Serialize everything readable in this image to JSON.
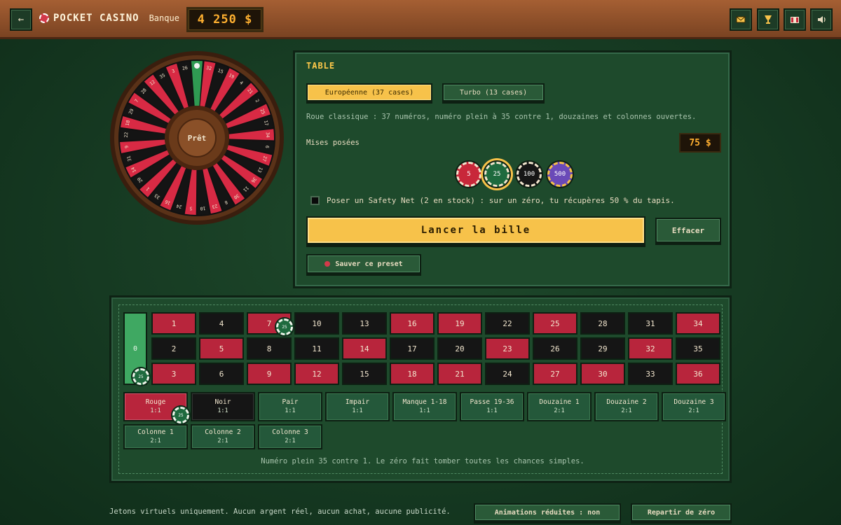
{
  "header": {
    "back_icon": "←",
    "brand": "POCKET CASINO",
    "bank_label": "Banque",
    "bank_value": "4 250 $",
    "icons": [
      "envelope-icon",
      "trophy-icon",
      "gift-icon",
      "speaker-icon"
    ]
  },
  "wheel": {
    "center_label": "Prêt",
    "numbers": [
      0,
      32,
      15,
      19,
      4,
      21,
      2,
      25,
      17,
      34,
      6,
      27,
      13,
      36,
      11,
      30,
      8,
      23,
      10,
      5,
      24,
      16,
      33,
      1,
      20,
      14,
      31,
      9,
      22,
      18,
      29,
      7,
      28,
      12,
      35,
      3,
      26
    ]
  },
  "table": {
    "title": "TABLE",
    "mode_european": "Européenne (37 cases)",
    "mode_turbo": "Turbo (13 cases)",
    "description": "Roue classique : 37 numéros, numéro plein à 35 contre 1, douzaines et colonnes ouvertes.",
    "mises_label": "Mises posées",
    "mises_value": "75 $",
    "chips": [
      {
        "label": "5",
        "color": "#c8283a"
      },
      {
        "label": "25",
        "color": "#1e6a3e"
      },
      {
        "label": "100",
        "color": "#161616"
      },
      {
        "label": "500",
        "color": "#6a4ab8"
      }
    ],
    "safety_net": "Poser un Safety Net (2 en stock) : sur un zéro, tu récupères 50 % du tapis.",
    "launch_label": "Lancer la bille",
    "clear_label": "Effacer",
    "preset_label": "Sauver ce preset"
  },
  "board": {
    "zero": "0",
    "rows": [
      [
        3,
        6,
        9,
        12,
        15,
        18,
        21,
        24,
        27,
        30,
        33,
        36
      ],
      [
        2,
        5,
        8,
        11,
        14,
        17,
        20,
        23,
        26,
        29,
        32,
        35
      ],
      [
        1,
        4,
        7,
        10,
        13,
        16,
        19,
        22,
        25,
        28,
        31,
        34
      ]
    ],
    "red_numbers": [
      1,
      3,
      5,
      7,
      9,
      12,
      14,
      16,
      18,
      19,
      21,
      23,
      25,
      27,
      30,
      32,
      34,
      36
    ],
    "outside_row1": [
      {
        "label": "Rouge",
        "odds": "1:1",
        "style": "red"
      },
      {
        "label": "Noir",
        "odds": "1:1",
        "style": "black"
      },
      {
        "label": "Pair",
        "odds": "1:1",
        "style": "green"
      },
      {
        "label": "Impair",
        "odds": "1:1",
        "style": "green"
      },
      {
        "label": "Manque 1-18",
        "odds": "1:1",
        "style": "green"
      },
      {
        "label": "Passe 19-36",
        "odds": "1:1",
        "style": "green"
      },
      {
        "label": "Douzaine 1",
        "odds": "2:1",
        "style": "green"
      },
      {
        "label": "Douzaine 2",
        "odds": "2:1",
        "style": "green"
      },
      {
        "label": "Douzaine 3",
        "odds": "2:1",
        "style": "green"
      }
    ],
    "outside_row2": [
      {
        "label": "Colonne 1",
        "odds": "2:1"
      },
      {
        "label": "Colonne 2",
        "odds": "2:1"
      },
      {
        "label": "Colonne 3",
        "odds": "2:1"
      }
    ],
    "placed_chip_label": "25",
    "note": "Numéro plein 35 contre 1. Le zéro fait tomber toutes les chances simples."
  },
  "footer": {
    "text": "Jetons virtuels uniquement. Aucun argent réel, aucun achat, aucune publicité.",
    "reduced_anim": "Animations réduites : non",
    "restart": "Repartir de zéro"
  }
}
